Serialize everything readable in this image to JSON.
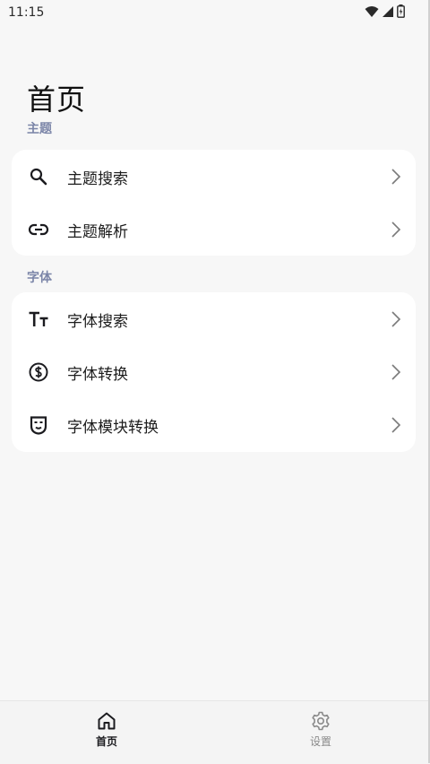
{
  "status_bar": {
    "time": "11:15",
    "icons": [
      "wifi-icon",
      "signal-icon",
      "battery-icon"
    ]
  },
  "page": {
    "title": "首页"
  },
  "sections": [
    {
      "label": "主题",
      "items": [
        {
          "label": "主题搜索",
          "icon": "search-icon"
        },
        {
          "label": "主题解析",
          "icon": "link-icon"
        }
      ]
    },
    {
      "label": "字体",
      "items": [
        {
          "label": "字体搜索",
          "icon": "font-size-icon"
        },
        {
          "label": "字体转换",
          "icon": "currency-exchange-icon"
        },
        {
          "label": "字体模块转换",
          "icon": "mask-icon"
        }
      ]
    }
  ],
  "bottom_nav": {
    "items": [
      {
        "label": "首页",
        "icon": "home-icon",
        "active": true
      },
      {
        "label": "设置",
        "icon": "gear-icon",
        "active": false
      }
    ]
  },
  "colors": {
    "background": "#f7f7f7",
    "card": "#ffffff",
    "section_label": "#7b85a8",
    "nav_active": "#1b1b1f",
    "nav_inactive": "#8a8a8a"
  }
}
